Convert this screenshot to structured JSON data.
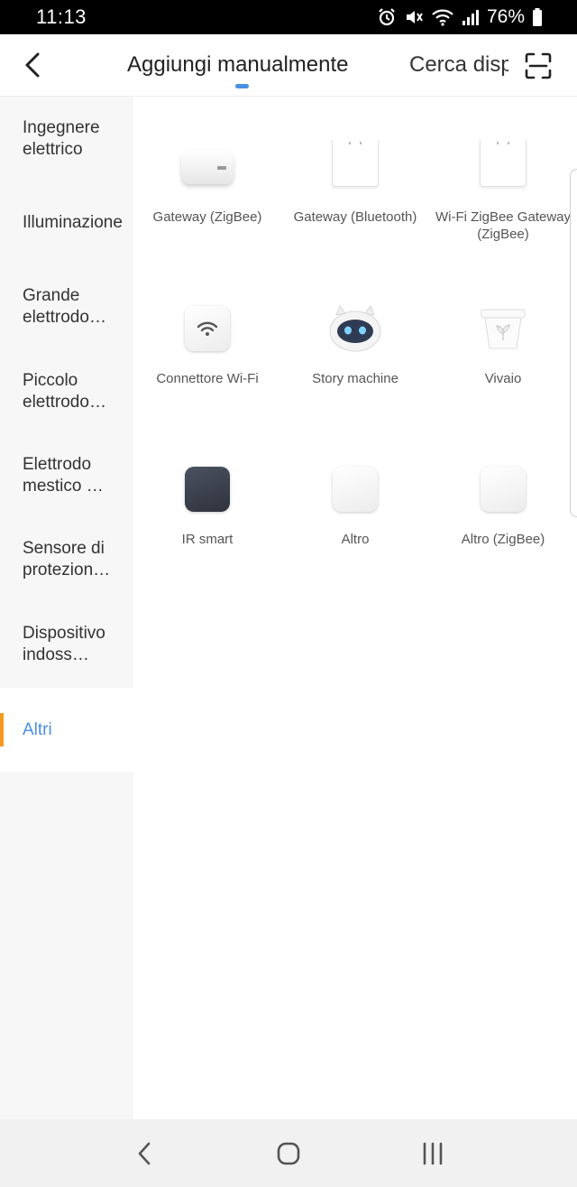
{
  "status_bar": {
    "time": "11:13",
    "battery_percent": "76%",
    "icons": [
      "alarm-icon",
      "mute-icon",
      "wifi-icon",
      "signal-icon",
      "battery-icon"
    ]
  },
  "header": {
    "back_icon": "chevron-left-icon",
    "tabs": [
      {
        "label": "Aggiungi manualmente",
        "active": true
      },
      {
        "label": "Cerca dispositivi",
        "active": false
      }
    ],
    "scan_icon": "scan-icon",
    "accent_color": "#4a90e2"
  },
  "sidebar": {
    "items": [
      {
        "label": "Ingegnere elettrico",
        "active": false
      },
      {
        "label": "Illuminazione",
        "active": false
      },
      {
        "label": "Grande elettrodo…",
        "active": false
      },
      {
        "label": "Piccolo elettrodo…",
        "active": false
      },
      {
        "label": "Elettrodo mestico …",
        "active": false
      },
      {
        "label": "Sensore di protezion…",
        "active": false
      },
      {
        "label": "Dispositivo indoss…",
        "active": false
      },
      {
        "label": "Altri",
        "active": true
      }
    ],
    "active_marker_color": "#f39a1e"
  },
  "devices": [
    {
      "label": "Gateway (ZigBee)",
      "icon": "gateway-hub-icon"
    },
    {
      "label": "Gateway (Bluetooth)",
      "icon": "gateway-box-icon"
    },
    {
      "label": "Wi-Fi ZigBee Gateway (ZigBee)",
      "icon": "gateway-box-icon"
    },
    {
      "label": "Connettore Wi-Fi",
      "icon": "wifi-connector-icon"
    },
    {
      "label": "Story machine",
      "icon": "robot-icon"
    },
    {
      "label": "Vivaio",
      "icon": "plant-pot-icon"
    },
    {
      "label": "IR smart",
      "icon": "ir-blaster-icon"
    },
    {
      "label": "Altro",
      "icon": "generic-device-icon"
    },
    {
      "label": "Altro (ZigBee)",
      "icon": "generic-device-icon"
    }
  ],
  "nav_bar": {
    "icons": [
      "nav-back-icon",
      "nav-home-icon",
      "nav-recents-icon"
    ]
  }
}
